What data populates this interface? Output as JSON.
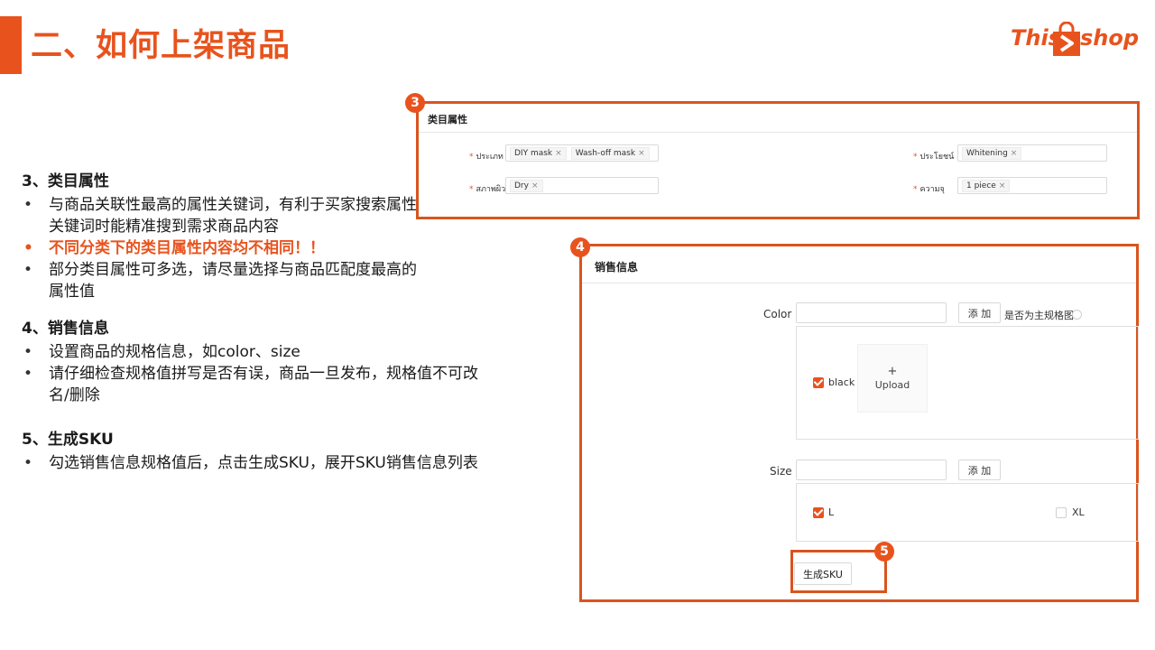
{
  "slide": {
    "title": "二、如何上架商品"
  },
  "logo": {
    "text_left": "This",
    "text_right": "shop",
    "color": "#e8531d"
  },
  "notes": {
    "sections": [
      {
        "title": "3、类目属性",
        "bullets": [
          "与商品关联性最高的属性关键词，有利于买家搜索属性关键词时能精准搜到需求商品内容",
          "不同分类下的类目属性内容均不相同！！",
          "部分类目属性可多选，请尽量选择与商品匹配度最高的属性值"
        ]
      },
      {
        "title": "4、销售信息",
        "bullets": [
          "设置商品的规格信息，如color、size",
          "请仔细检查规格值拼写是否有误，商品一旦发布，规格值不可改名/删除"
        ]
      },
      {
        "title": "5、生成SKU",
        "bullets": [
          "勾选销售信息规格值后，点击生成SKU，展开SKU销售信息列表"
        ]
      }
    ]
  },
  "callouts": {
    "badge3": "3",
    "badge4": "4",
    "badge5": "5"
  },
  "category_attributes": {
    "title": "类目属性",
    "fields": [
      {
        "label": "ประเภท",
        "tags": [
          "DIY mask",
          "Wash-off mask"
        ]
      },
      {
        "label": "ประโยชน์",
        "tags": [
          "Whitening"
        ]
      },
      {
        "label": "สภาพผิว",
        "tags": [
          "Dry"
        ]
      },
      {
        "label": "ความจุ",
        "tags": [
          "1 piece"
        ]
      }
    ],
    "remove_glyph": "×"
  },
  "sales_info": {
    "title": "销售信息",
    "color": {
      "label": "Color",
      "add_button": "添 加",
      "main_spec_label": "是否为主规格图",
      "value_input": "",
      "options": [
        {
          "label": "black",
          "checked": true
        }
      ],
      "upload": {
        "plus": "+",
        "label": "Upload"
      }
    },
    "size": {
      "label": "Size",
      "add_button": "添 加",
      "value_input": "",
      "options": [
        {
          "label": "L",
          "checked": true
        },
        {
          "label": "XL",
          "checked": false
        }
      ]
    },
    "generate_sku_button": "生成SKU"
  }
}
